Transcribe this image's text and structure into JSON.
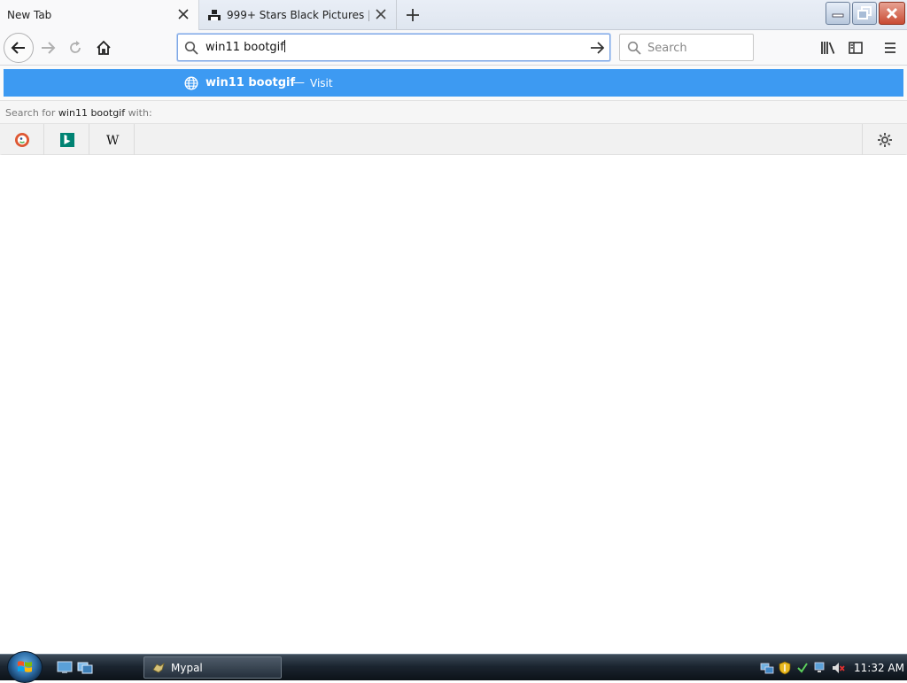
{
  "tabs": [
    {
      "title": "New Tab",
      "active": true
    },
    {
      "title": "999+ Stars Black Pictures | Dov",
      "active": false
    }
  ],
  "navbar": {
    "url_value": "win11 bootgif",
    "search_placeholder": "Search"
  },
  "popup": {
    "result_title": "win11 bootgif",
    "result_sep": "—",
    "result_action": "Visit",
    "search_for_prefix": "Search for",
    "search_for_query": "win11 bootgif",
    "search_for_suffix": "with:",
    "engines": [
      "DuckDuckGo",
      "Bing",
      "Wikipedia"
    ]
  },
  "taskbar": {
    "task_label": "Mypal",
    "clock": "11:32 AM"
  },
  "colors": {
    "accent": "#3d9af2",
    "taskbar": "#1b2530"
  }
}
